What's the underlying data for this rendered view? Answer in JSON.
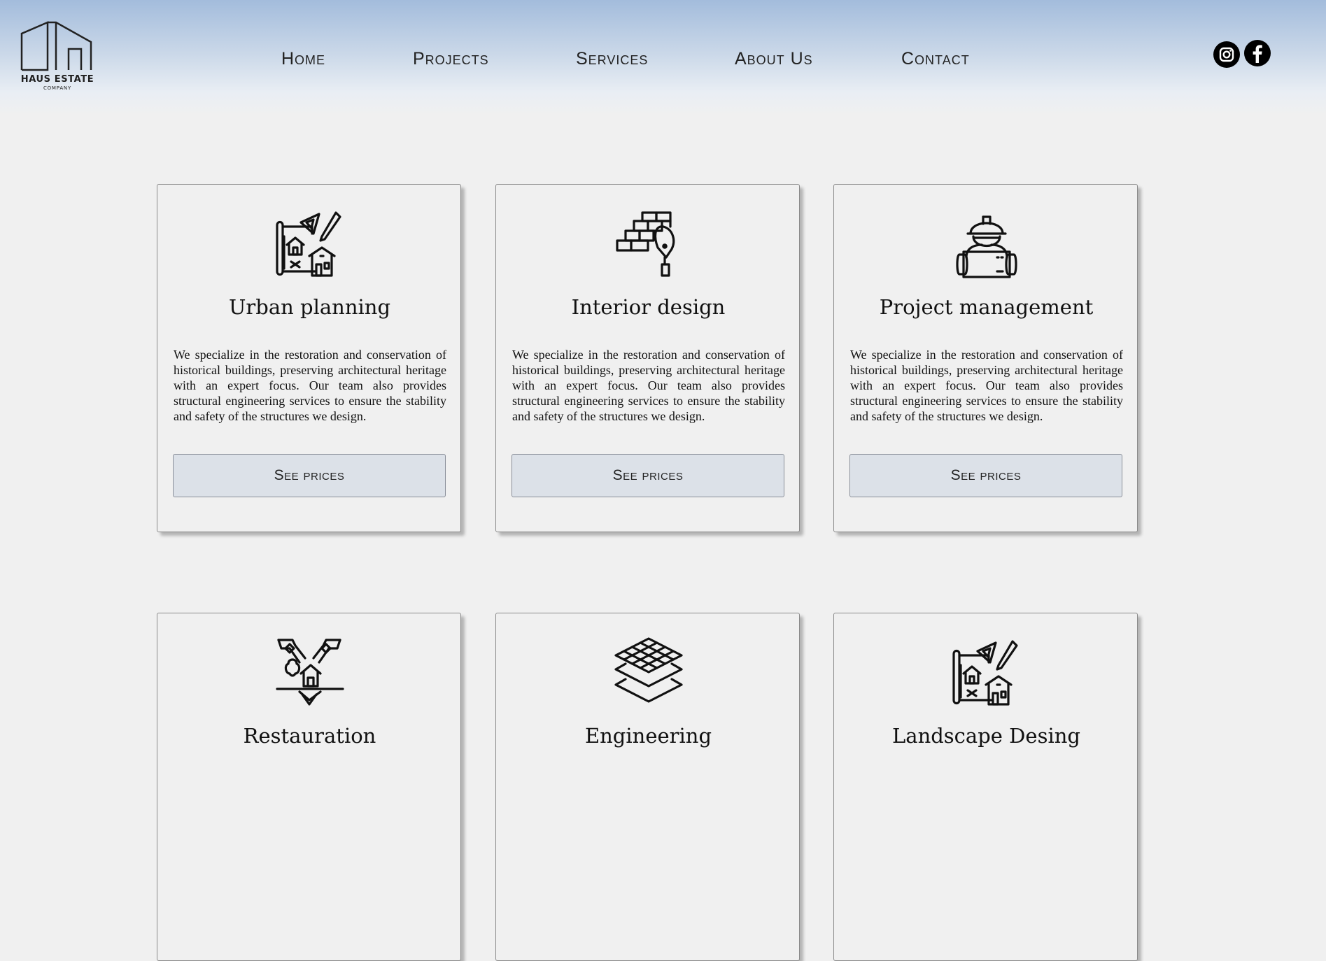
{
  "header": {
    "logo": {
      "name": "HAUS ESTATE",
      "sub": "COMPANY"
    },
    "nav": [
      "Home",
      "Projects",
      "Services",
      "About Us",
      "Contact"
    ],
    "social": [
      "instagram-icon",
      "facebook-icon"
    ]
  },
  "services": [
    {
      "icon": "urban-planning-icon",
      "title": "Urban planning",
      "description": "We specialize in the restoration and conservation of historical buildings, preserving architectural heritage with an expert focus. Our team also provides structural engineering services to ensure the stability and safety of the structures we design.",
      "button": "See prices"
    },
    {
      "icon": "interior-design-icon",
      "title": "Interior design",
      "description": "We specialize in the restoration and conservation of historical buildings, preserving architectural heritage with an expert focus. Our team also provides structural engineering services to ensure the stability and safety of the structures we design.",
      "button": "See prices"
    },
    {
      "icon": "project-management-icon",
      "title": "Project management",
      "description": "We specialize in the restoration and conservation of historical buildings, preserving architectural heritage with an expert focus. Our team also provides structural engineering services to ensure the stability and safety of the structures we design.",
      "button": "See prices"
    },
    {
      "icon": "restauration-icon",
      "title": "Restauration"
    },
    {
      "icon": "engineering-icon",
      "title": "Engineering"
    },
    {
      "icon": "landscape-design-icon",
      "title": "Landscape Desing"
    }
  ],
  "colors": {
    "header_top": "#a3bcdc",
    "background": "#f0f0f0",
    "button_bg": "#dce1e8"
  }
}
